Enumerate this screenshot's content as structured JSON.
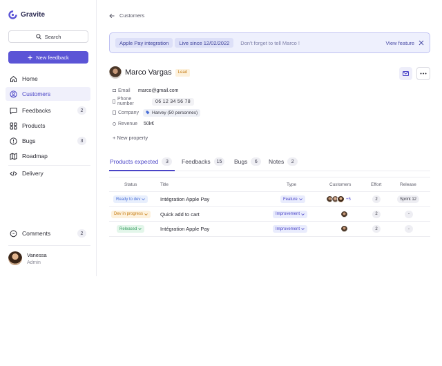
{
  "app": {
    "name": "Gravite",
    "brand_color": "#5b54d6"
  },
  "sidebar": {
    "search_label": "Search",
    "new_feedback_label": "New feedback",
    "items": [
      {
        "label": "Home",
        "icon": "home-icon"
      },
      {
        "label": "Customers",
        "icon": "user-circle-icon",
        "active": true
      },
      {
        "label": "Feedbacks",
        "icon": "message-icon",
        "count": "2"
      },
      {
        "label": "Products",
        "icon": "grid-icon"
      },
      {
        "label": "Bugs",
        "icon": "alert-circle-icon",
        "count": "3"
      },
      {
        "label": "Roadmap",
        "icon": "map-icon"
      },
      {
        "label": "Delivery",
        "icon": "code-icon"
      }
    ],
    "comments": {
      "label": "Comments",
      "icon": "chat-bubble-icon",
      "count": "2"
    },
    "user": {
      "name": "Vanessa",
      "role": "Admin"
    }
  },
  "breadcrumb": {
    "label": "Customers"
  },
  "banner": {
    "chip_feature": "Apple Pay integration",
    "chip_live": "Live since 12/02/2022",
    "note": "Don't forget to tell Marco !",
    "view_label": "View feature"
  },
  "profile": {
    "name": "Marco Vargas",
    "badge": "Lead",
    "properties": {
      "email_label": "Email",
      "email_value": "marco@gmail.com",
      "phone_label": "Phone number",
      "phone_value": "06 12 34 56 78",
      "company_label": "Company",
      "company_value": "Harvey (50 personnes)",
      "revenue_label": "Revenue",
      "revenue_value": "50k€"
    },
    "add_property_label": "+ New property"
  },
  "tabs": [
    {
      "label": "Products expected",
      "count": "3",
      "active": true
    },
    {
      "label": "Feedbacks",
      "count": "15"
    },
    {
      "label": "Bugs",
      "count": "6"
    },
    {
      "label": "Notes",
      "count": "2"
    }
  ],
  "table": {
    "headers": {
      "status": "Status",
      "title": "Title",
      "type": "Type",
      "customers": "Customers",
      "effort": "Effort",
      "release": "Release"
    },
    "rows": [
      {
        "status": "Ready to dev",
        "status_color": "#4a6fd6",
        "status_bg": "#e8effd",
        "title": "Intégration Apple Pay",
        "type": "Feature",
        "customers_extra": "+5",
        "effort": "2",
        "release": "Sprint 12"
      },
      {
        "status": "Dev in progress",
        "status_color": "#c57b12",
        "status_bg": "#fdf1dc",
        "title": "Quick add to cart",
        "type": "Improvement",
        "effort": "2",
        "release": "-"
      },
      {
        "status": "Released",
        "status_color": "#2f9a5a",
        "status_bg": "#e3f6ea",
        "title": "Intégration Apple Pay",
        "type": "Improvement",
        "effort": "2",
        "release": "-"
      }
    ]
  }
}
